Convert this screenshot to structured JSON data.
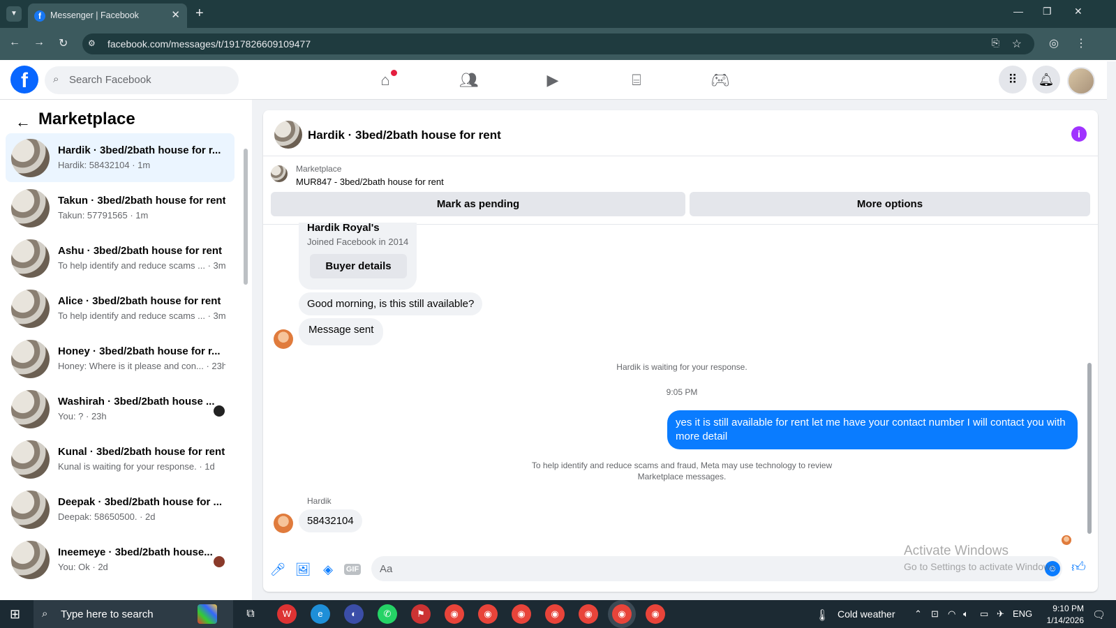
{
  "browser": {
    "tab_title": "Messenger | Facebook",
    "url": "facebook.com/messages/t/1917826609109477"
  },
  "facebook": {
    "search_placeholder": "Search Facebook"
  },
  "sidebar": {
    "title": "Marketplace",
    "conversations": [
      {
        "name": "Hardik · 3bed/2bath house for r...",
        "preview": "Hardik: 58432104 · 1m"
      },
      {
        "name": "Takun · 3bed/2bath house for rent",
        "preview": "Takun: 57791565 · 1m"
      },
      {
        "name": "Ashu · 3bed/2bath house for rent",
        "preview": "To help identify and reduce scams ... · 3m"
      },
      {
        "name": "Alice · 3bed/2bath house for rent",
        "preview": "To help identify and reduce scams ... · 3m"
      },
      {
        "name": "Honey · 3bed/2bath house for r...",
        "preview": "Honey: Where is it please and con... · 23h"
      },
      {
        "name": "Washirah · 3bed/2bath house ...",
        "preview": "You: ? · 23h"
      },
      {
        "name": "Kunal · 3bed/2bath house for rent",
        "preview": "Kunal is waiting for your response. · 1d"
      },
      {
        "name": "Deepak · 3bed/2bath house for ...",
        "preview": "Deepak: 58650500. · 2d"
      },
      {
        "name": "Ineemeye · 3bed/2bath house...",
        "preview": "You: Ok · 2d"
      }
    ]
  },
  "chat": {
    "title": "Hardik · 3bed/2bath house for rent",
    "marketplace_label": "Marketplace",
    "listing": "MUR847 - 3bed/2bath house for rent",
    "mark_pending_label": "Mark as pending",
    "more_options_label": "More options",
    "buyer_name": "Hardik Royal's",
    "buyer_joined": "Joined Facebook in 2014",
    "buyer_details_label": "Buyer details",
    "msg1": "Good morning, is this still available?",
    "msg2": "Message sent",
    "waiting": "Hardik is waiting for your response.",
    "time": "9:05 PM",
    "my_msg": "yes it is still available for rent let me have your contact number I will contact you with more detail",
    "notice_line1": "To help identify and reduce scams and fraud, Meta may use technology to review",
    "notice_line2": "Marketplace messages.",
    "sender": "Hardik",
    "last_msg": "58432104",
    "composer_placeholder": "Aa"
  },
  "watermark": {
    "line1": "Activate Windows",
    "line2": "Go to Settings to activate Windows."
  },
  "taskbar": {
    "search_placeholder": "Type here to search",
    "weather": "Cold weather",
    "lang": "ENG",
    "time": "9:10 PM",
    "date": "1/14/2026"
  }
}
